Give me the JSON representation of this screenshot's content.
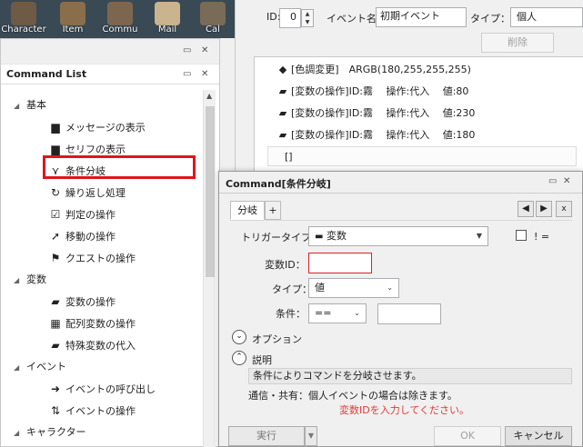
{
  "toolbar": {
    "buttons": [
      {
        "label": "Character",
        "color": "#6e5a45"
      },
      {
        "label": "Item",
        "color": "#8a6e4c"
      },
      {
        "label": "Commu",
        "color": "#7d6650"
      },
      {
        "label": "Mail",
        "color": "#c9b48f"
      },
      {
        "label": "Cal",
        "color": "#7a6b58"
      }
    ]
  },
  "command_list": {
    "title": "Command List",
    "win_controls": [
      "▭",
      "✕"
    ],
    "categories": [
      {
        "label": "基本",
        "items": [
          {
            "label": "メッセージの表示",
            "icon": "message-icon"
          },
          {
            "label": "セリフの表示",
            "icon": "speech-icon"
          },
          {
            "label": "条件分岐",
            "icon": "branch-icon"
          },
          {
            "label": "繰り返し処理",
            "icon": "loop-icon"
          },
          {
            "label": "判定の操作",
            "icon": "check-icon"
          },
          {
            "label": "移動の操作",
            "icon": "move-icon"
          },
          {
            "label": "クエストの操作",
            "icon": "flag-icon"
          }
        ]
      },
      {
        "label": "変数",
        "items": [
          {
            "label": "変数の操作",
            "icon": "variable-icon"
          },
          {
            "label": "配列変数の操作",
            "icon": "array-icon"
          },
          {
            "label": "特殊変数の代入",
            "icon": "special-variable-icon"
          }
        ]
      },
      {
        "label": "イベント",
        "items": [
          {
            "label": "イベントの呼び出し",
            "icon": "call-arrow-icon"
          },
          {
            "label": "イベントの操作",
            "icon": "event-op-icon"
          }
        ]
      },
      {
        "label": "キャラクター",
        "items": [
          {
            "label": "",
            "icon": "character-icon"
          }
        ]
      }
    ]
  },
  "event": {
    "id_label": "ID:",
    "id_value": "0",
    "name_label": "イベント名：",
    "name_value": "初期イベント",
    "type_label": "タイプ：",
    "type_value": "個人",
    "delete_button": "削除",
    "commands": [
      {
        "icon": "color-tone-icon",
        "text": "[色調変更]　ARGB(180,255,255,255)"
      },
      {
        "icon": "variable-icon",
        "text": "[変数の操作]ID:霧　 操作:代入　 値:80"
      },
      {
        "icon": "variable-icon",
        "text": "[変数の操作]ID:霧　 操作:代入　 値:230"
      },
      {
        "icon": "variable-icon",
        "text": "[変数の操作]ID:霧　 操作:代入　 値:180"
      },
      {
        "icon": "",
        "text": "[]"
      }
    ]
  },
  "dialog": {
    "title": "Command[条件分岐]",
    "win_controls": [
      "▭",
      "✕"
    ],
    "tabs": [
      {
        "label": "分岐"
      },
      {
        "label": "+"
      }
    ],
    "nav": {
      "prev": "◀",
      "next": "▶",
      "close": "x"
    },
    "trigger_label": "トリガータイプ：",
    "trigger_value": "変数",
    "not_label": "! =",
    "var_id_label": "変数ID：",
    "var_id_value": "",
    "type_label": "タイプ：",
    "type_value": "値",
    "condition_label": "条件：",
    "condition_value": "==",
    "condition_input": "",
    "option_label": "オプション",
    "description_label": "説明",
    "description_text": "条件によりコマンドを分岐させます。",
    "note_text": "通信・共有：個人イベントの場合は除きます。",
    "error_text": "変数IDを入力してください。",
    "execute_button": "実行",
    "ok_button": "OK",
    "cancel_button": "キャンセル",
    "error_color": "#e53935",
    "highlight_color": "#e2141b"
  }
}
